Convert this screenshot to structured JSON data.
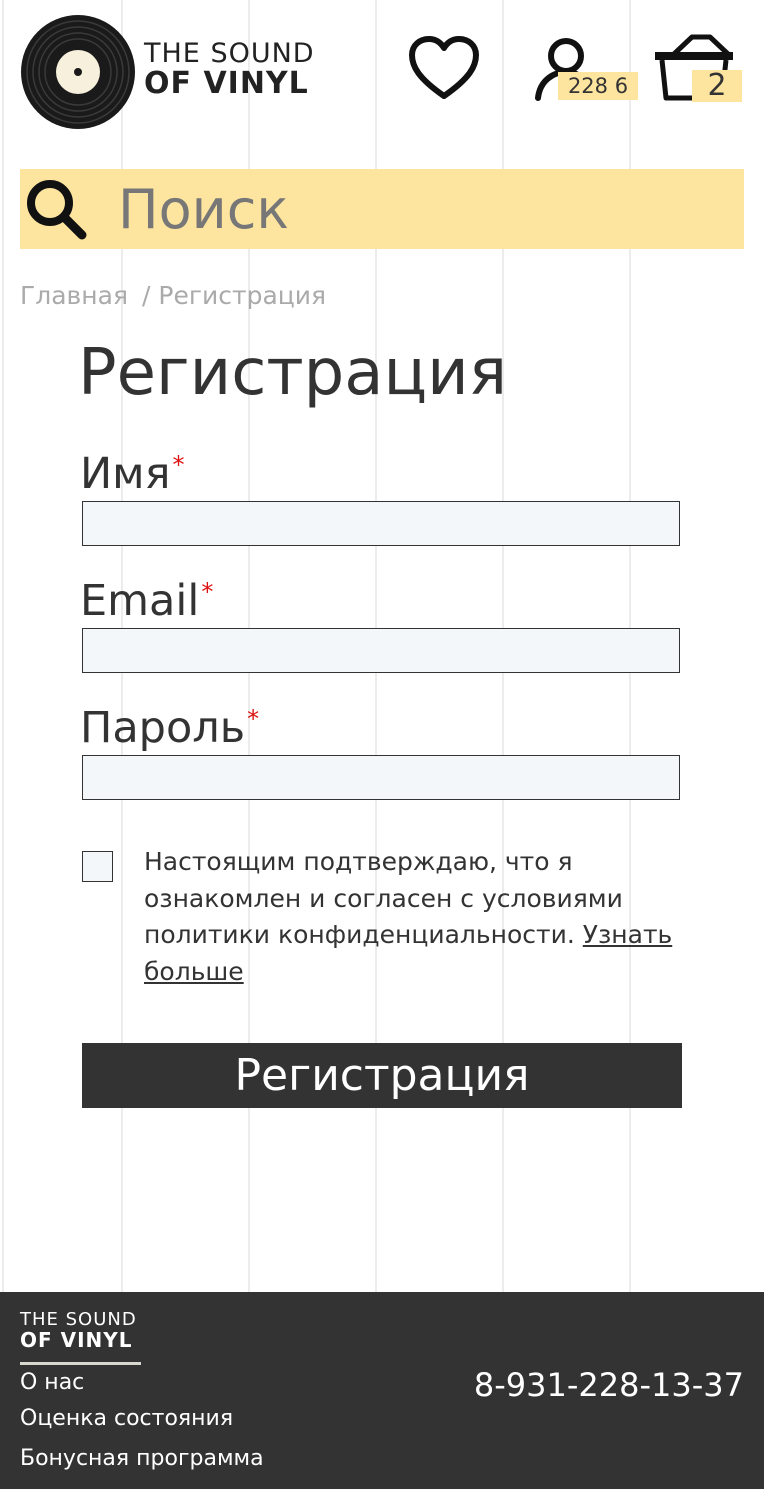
{
  "brand": {
    "line1": "THE SOUND",
    "line2": "OF VINYL"
  },
  "header": {
    "account_badge": "228 6",
    "cart_badge": "2"
  },
  "search": {
    "placeholder": "Поиск"
  },
  "breadcrumb": {
    "home": "Главная",
    "separator": "/",
    "current": "Регистрация"
  },
  "page_title": "Регистрация",
  "form": {
    "name_label": "Имя",
    "email_label": "Email",
    "password_label": "Пароль",
    "required_mark": "*",
    "name_value": "",
    "email_value": "",
    "password_value": "",
    "consent_text": "Настоящим подтверждаю, что я ознакомлен и согласен с условиями политики конфиденциальности.",
    "consent_link": "Узнать больше",
    "consent_checked": false,
    "submit_label": "Регистрация"
  },
  "footer": {
    "brand_line1": "THE SOUND",
    "brand_line2": "OF VINYL",
    "links": [
      "О нас",
      "Оценка состояния",
      "Бонусная программа"
    ],
    "phone": "8-931-228-13-37"
  },
  "colors": {
    "accent": "#fde59f",
    "dark": "#333333",
    "field_bg": "#f3f7fa",
    "required": "#dd1111"
  },
  "icons": [
    "vinyl-record-logo",
    "heart-icon",
    "user-icon",
    "basket-icon",
    "search-icon"
  ]
}
